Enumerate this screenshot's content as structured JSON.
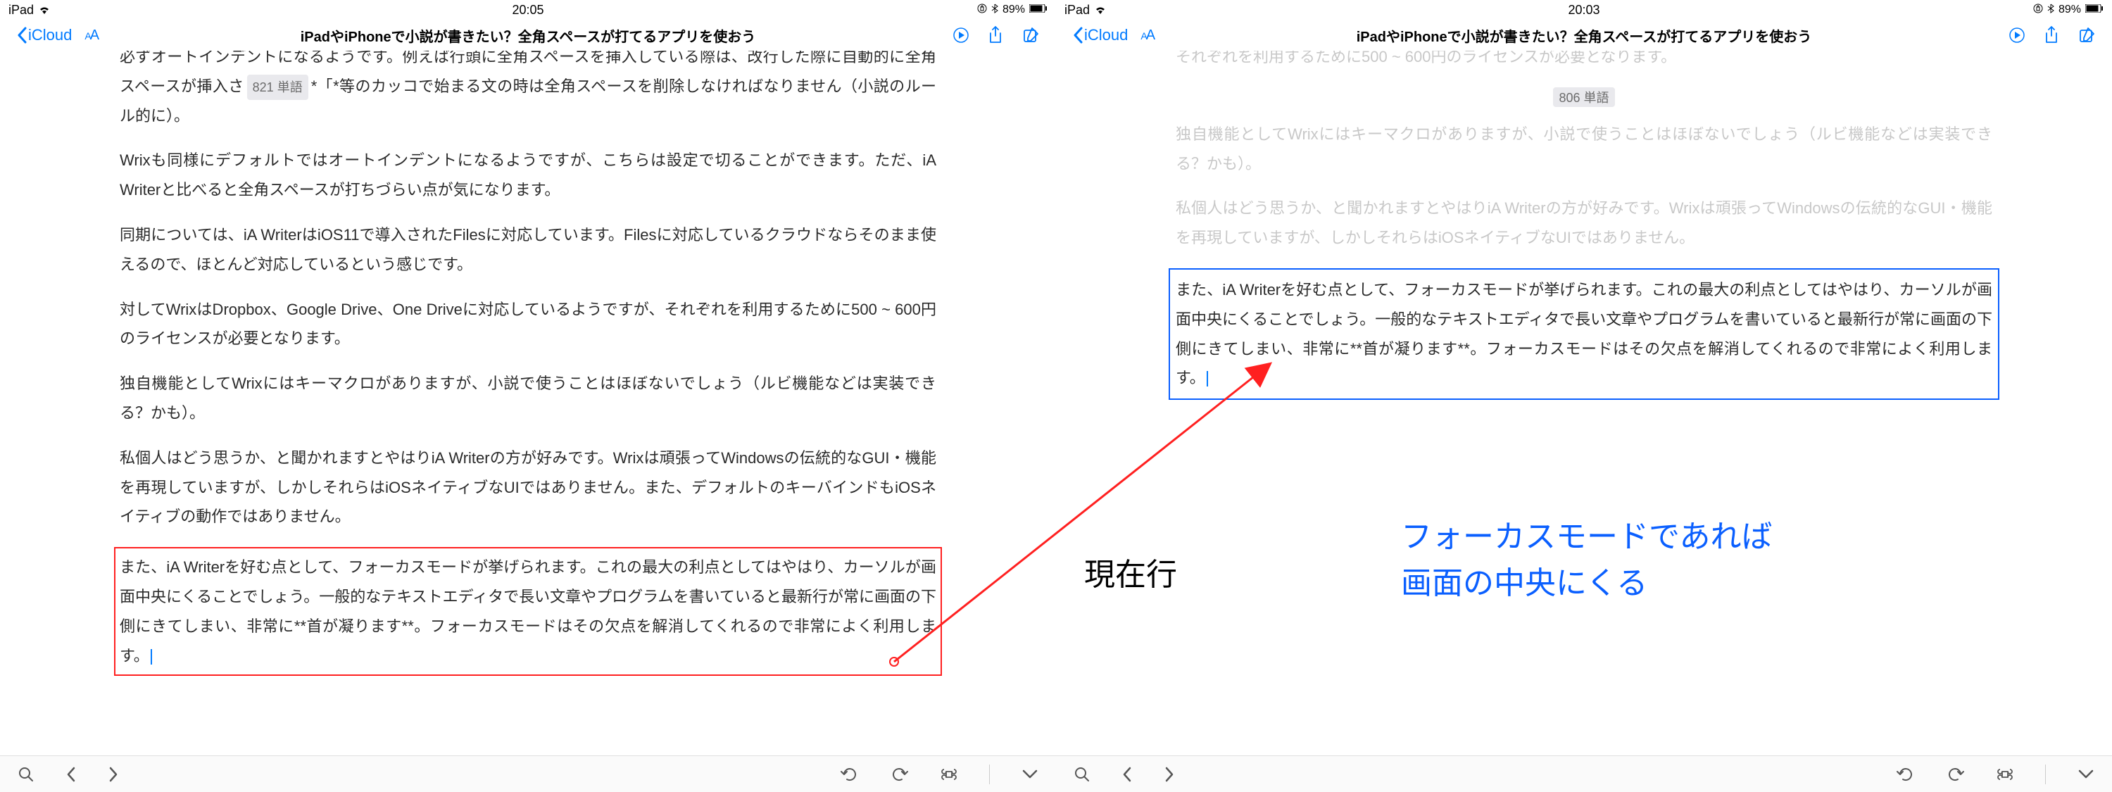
{
  "left": {
    "status": {
      "device": "iPad",
      "time": "20:05",
      "battery_pct": "89%"
    },
    "nav": {
      "back": "iCloud",
      "title": "iPadやiPhoneで小説が書きたい？全角スペースが打てるアプリを使おう"
    },
    "word_count": "821 単語",
    "p_top_a": "必ずオートインデントになるようです。例えば行頭に全角スペースを挿入している際は、改行した際に自動的に全角スペースが挿入さ",
    "p_top_b": "*「*等のカッコで始まる文の時は全角スペースを削除しなければなりません（小説のルール的に）。",
    "p2": "Wrixも同様にデフォルトではオートインデントになるようですが、こちらは設定で切ることができます。ただ、iA Writerと比べると全角スペースが打ちづらい点が気になります。",
    "p3": "同期については、iA WriterはiOS11で導入されたFilesに対応しています。Filesに対応しているクラウドならそのまま使えるので、ほとんど対応しているという感じです。",
    "p4": "対してWrixはDropbox、Google Drive、One Driveに対応しているようですが、それぞれを利用するために500 ~ 600円のライセンスが必要となります。",
    "p5": "独自機能としてWrixにはキーマクロがありますが、小説で使うことはほぼないでしょう（ルビ機能などは実装できる？かも）。",
    "p6": "私個人はどう思うか、と聞かれますとやはりiA Writerの方が好みです。Wrixは頑張ってWindowsの伝統的なGUI・機能を再現していますが、しかしそれらはiOSネイティブなUIではありません。また、デフォルトのキーバインドもiOSネイティブの動作ではありません。",
    "p_focus": "また、iA Writerを好む点として、フォーカスモードが挙げられます。これの最大の利点としてはやはり、カーソルが画面中央にくることでしょう。一般的なテキストエディタで長い文章やプログラムを書いていると最新行が常に画面の下側にきてしまい、非常に**首が凝ります**。フォーカスモードはその欠点を解消してくれるので非常によく利用します。"
  },
  "right": {
    "status": {
      "device": "iPad",
      "time": "20:03",
      "battery_pct": "89%"
    },
    "nav": {
      "back": "iCloud",
      "title": "iPadやiPhoneで小説が書きたい？全角スペースが打てるアプリを使おう"
    },
    "word_count": "806 単語",
    "p_top": "それぞれを利用するために500 ~ 600円のライセンスが必要となります。",
    "p2": "独自機能としてWrixにはキーマクロがありますが、小説で使うことはほぼないでしょう（ルビ機能などは実装できる？かも）。",
    "p3": "私個人はどう思うか、と聞かれますとやはりiA Writerの方が好みです。Wrixは頑張ってWindowsの伝統的なGUI・機能を再現していますが、しかしそれらはiOSネイティブなUIではありません。",
    "p_focus": "また、iA Writerを好む点として、フォーカスモードが挙げられます。これの最大の利点としてはやはり、カーソルが画面中央にくることでしょう。一般的なテキストエディタで長い文章やプログラムを書いていると最新行が常に画面の下側にきてしまい、非常に**首が凝ります**。フォーカスモードはその欠点を解消してくれるので非常によく利用します。"
  },
  "annotation": {
    "black": "現在行",
    "blue_l1": "フォーカスモードであれば",
    "blue_l2": "画面の中央にくる"
  }
}
